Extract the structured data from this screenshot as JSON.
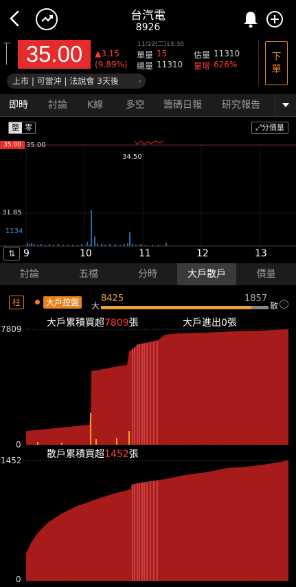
{
  "header": {
    "title": "台汽電",
    "code": "8926"
  },
  "quote": {
    "price": "35.00",
    "change": "▲3.15",
    "change_pct": "(9.89%)",
    "datetime": "11/22(二)13:30",
    "unit_vol_label": "單量",
    "unit_vol": "15",
    "total_vol_label": "總量",
    "total_vol": "11310",
    "est_vol_label": "估量",
    "est_vol": "11310",
    "vol_increase_label": "量增",
    "vol_increase": "626%",
    "order_button": "下單",
    "tags": "上市 | 可當沖 | 法說會 3天後"
  },
  "tabs_top": [
    "即時",
    "討論",
    "K線",
    "多空",
    "籌碼日報",
    "研究報告"
  ],
  "intraday": {
    "whole_lot": "整",
    "odd_lot": "零",
    "dist_button": "分價量",
    "price_tag": "35.00",
    "price_label": "35.00",
    "low_label": "34.50",
    "mid_label": "31.85",
    "vol_label": "1134",
    "x_ticks": [
      "9",
      "10",
      "11",
      "12",
      "13"
    ]
  },
  "tabs_bottom": [
    "討論",
    "五檔",
    "分時",
    "大戶散戶",
    "價量"
  ],
  "big_retail": {
    "col_btn": "柱",
    "control_label": "大戶控盤",
    "big_label": "大",
    "big_value": "8425",
    "retail_value": "1857",
    "retail_label": "散",
    "big_cum_prefix": "大戶累積買超",
    "big_cum_value": "7809",
    "big_cum_unit": "張",
    "big_inout": "大戶進出0張",
    "big_axis_top": "7809",
    "big_axis_bottom": "0",
    "retail_cum_prefix": "散戶累積買超",
    "retail_cum_value": "1452",
    "retail_cum_unit": "張",
    "retail_axis_top": "1452",
    "retail_axis_bottom": "0"
  },
  "colors": {
    "up": "#ff3b3b",
    "accent": "#e8821e",
    "area": "#a81b1b"
  }
}
